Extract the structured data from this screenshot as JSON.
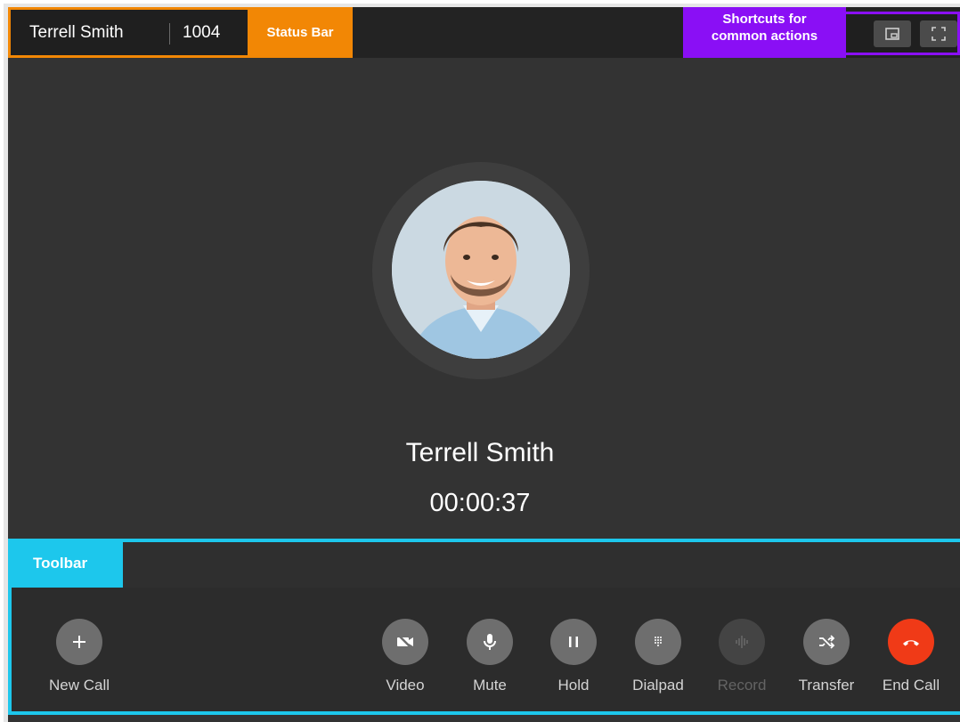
{
  "status_bar": {
    "caller_name": "Terrell Smith",
    "extension": "1004",
    "annotation": "Status Bar"
  },
  "shortcuts": {
    "annotation_line1": "Shortcuts for",
    "annotation_line2": "common actions",
    "buttons": [
      {
        "icon": "picture-in-picture-icon"
      },
      {
        "icon": "fullscreen-icon"
      }
    ]
  },
  "call": {
    "contact_name": "Terrell Smith",
    "duration": "00:00:37"
  },
  "toolbar": {
    "annotation": "Toolbar",
    "buttons": [
      {
        "label": "New Call",
        "icon": "plus-icon",
        "enabled": true
      },
      {
        "label": "Video",
        "icon": "video-off-icon",
        "enabled": true
      },
      {
        "label": "Mute",
        "icon": "microphone-icon",
        "enabled": true
      },
      {
        "label": "Hold",
        "icon": "pause-icon",
        "enabled": true
      },
      {
        "label": "Dialpad",
        "icon": "dialpad-icon",
        "enabled": true
      },
      {
        "label": "Record",
        "icon": "waveform-icon",
        "enabled": false
      },
      {
        "label": "Transfer",
        "icon": "transfer-icon",
        "enabled": true
      },
      {
        "label": "End Call",
        "icon": "hangup-icon",
        "enabled": true
      }
    ]
  },
  "colors": {
    "status_annotation": "#f28705",
    "shortcut_annotation": "#8a0ff5",
    "toolbar_annotation": "#1dc7ec",
    "end_call": "#f03a17",
    "background": "#333333"
  }
}
